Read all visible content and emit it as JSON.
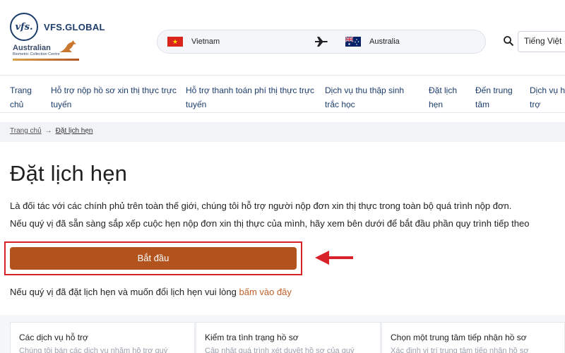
{
  "brand": {
    "logo_mark": "vfs.",
    "name": "VFS.GLOBAL"
  },
  "partner": {
    "title": "Australian",
    "subtitle": "Biometric Collection Centre"
  },
  "route": {
    "from": "Vietnam",
    "from_flag": "vietnam-flag",
    "to": "Australia",
    "to_flag": "australia-flag",
    "icon": "airplane-icon"
  },
  "header": {
    "search_icon": "search-icon",
    "language": "Tiếng Việt"
  },
  "nav": {
    "items": [
      {
        "line1": "Trang",
        "line2": "chủ"
      },
      {
        "line1": "Hỗ trợ nộp hồ sơ xin thị thực trực",
        "line2": "tuyến"
      },
      {
        "line1": "Hỗ trợ thanh toán phí thị thực trực",
        "line2": "tuyến"
      },
      {
        "line1": "Dịch vụ thu thập sinh",
        "line2": "trắc học"
      },
      {
        "line1": "Đặt lịch",
        "line2": "hẹn"
      },
      {
        "line1": "Đến trung",
        "line2": "tâm"
      },
      {
        "line1": "Dịch vụ h",
        "line2": "trợ"
      }
    ]
  },
  "breadcrumb": {
    "home": "Trang chủ",
    "separator": "→",
    "current": "Đặt lịch hẹn"
  },
  "main": {
    "title": "Đặt lịch hẹn",
    "intro_line1": "Là đối tác với các chính phủ trên toàn thế giới, chúng tôi hỗ trợ người nộp đơn xin thị thực trong toàn bộ quá trình nộp đơn.",
    "intro_line2": "Nếu quý vị đã sẵn sàng sắp xếp cuộc hẹn nộp đơn xin thị thực của mình, hãy xem bên dưới để bắt đầu phần quy trình tiếp theo",
    "start_button": "Bắt đầu",
    "reschedule_text": "Nếu quý vị đã đặt lịch hẹn và muốn đổi lịch hẹn vui lòng ",
    "reschedule_link": "bấm vào đây"
  },
  "cards": [
    {
      "title": "Các dịch vụ hỗ trợ",
      "subtitle": "Chúng tôi bán các dịch vụ nhằm hỗ trợ quý"
    },
    {
      "title": "Kiểm tra tình trạng hồ sơ",
      "subtitle": "Cập nhật quá trình xét duyệt hồ sơ của quý"
    },
    {
      "title": "Chọn một trung tâm tiếp nhận hồ sơ",
      "subtitle": "Xác định vị trí trung tâm tiếp nhận hồ sơ"
    }
  ],
  "colors": {
    "brand_navy": "#1c3c6c",
    "button": "#b2521d",
    "link": "#c0622b",
    "annotation_red": "#d8232a"
  }
}
